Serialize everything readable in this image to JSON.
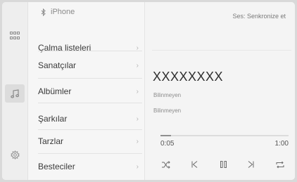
{
  "source": {
    "label": "iPhone",
    "icon": "bluetooth-icon"
  },
  "rail": {
    "icons": [
      "apps-grid-icon",
      "music-note-icon",
      "settings-gear-icon"
    ]
  },
  "menu": {
    "items": [
      {
        "label": "Çalma listeleri"
      },
      {
        "label": "Sanatçılar"
      },
      {
        "label": "Albümler"
      },
      {
        "label": "Şarkılar"
      },
      {
        "label": "Tarzlar"
      },
      {
        "label": "Besteciler"
      }
    ],
    "chevron": "›"
  },
  "header": {
    "sync_label": "Ses:  Senkronize et"
  },
  "track": {
    "title": "XXXXXXXX",
    "artist": "Bilinmeyen",
    "album": "Bilinmeyen"
  },
  "playback": {
    "elapsed": "0:05",
    "total": "1:00",
    "progress_fraction": 0.083
  },
  "controls": [
    "shuffle-icon",
    "previous-icon",
    "pause-icon",
    "next-icon",
    "repeat-icon"
  ],
  "colors": {
    "background": "#f6f6f6",
    "text": "#3a3a3a",
    "muted": "#8a8a8a"
  }
}
